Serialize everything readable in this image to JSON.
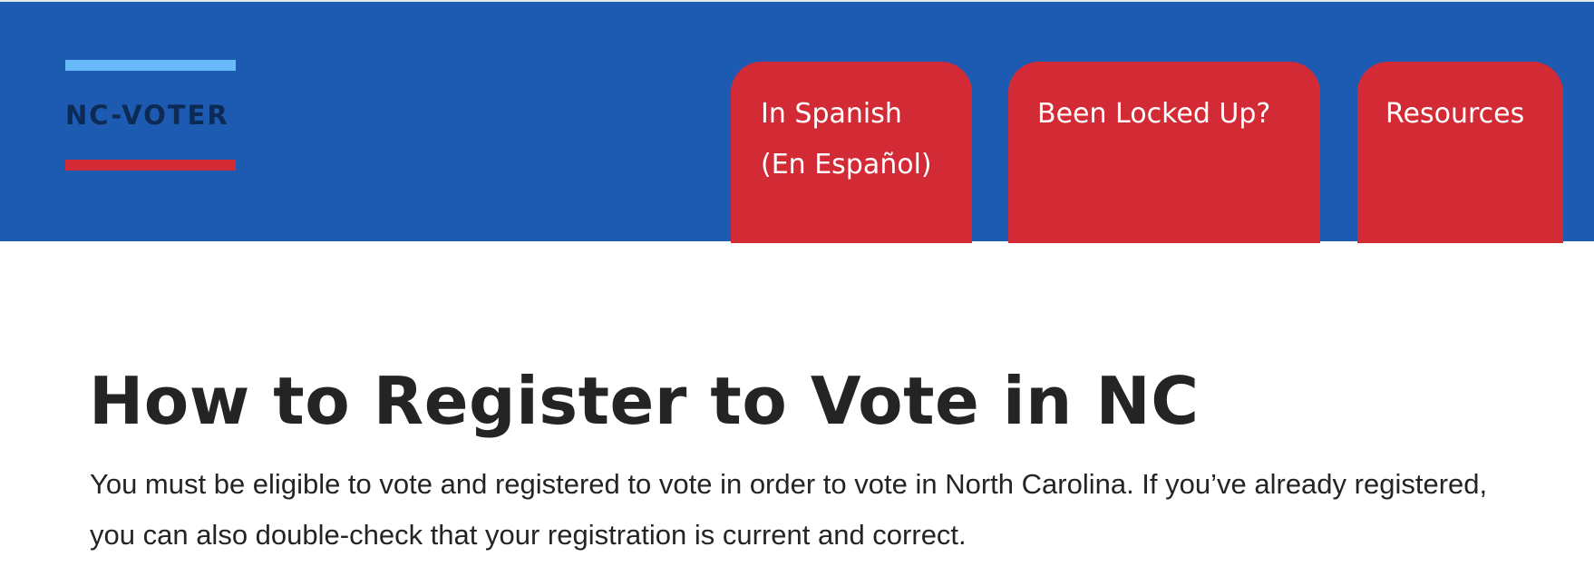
{
  "colors": {
    "header_bg": "#1d5ab2",
    "nav_tab_bg": "#d32b36",
    "logo_text": "#0d2a55",
    "logo_top_bar": "#66bbf8",
    "logo_bottom_bar": "#d32b36",
    "body_text": "#242424"
  },
  "logo": {
    "text": "NC-VOTER"
  },
  "nav": {
    "tabs": [
      {
        "line1": "In Spanish",
        "line2": "(En Español)"
      },
      {
        "line1": "Been Locked Up?"
      },
      {
        "line1": "Resources"
      }
    ]
  },
  "main": {
    "title": "How to Register to Vote in NC",
    "intro": "You must be eligible to vote and registered to vote in order to vote in North Carolina. If you’ve already registered, you can also double-check that your registration is current and correct."
  }
}
